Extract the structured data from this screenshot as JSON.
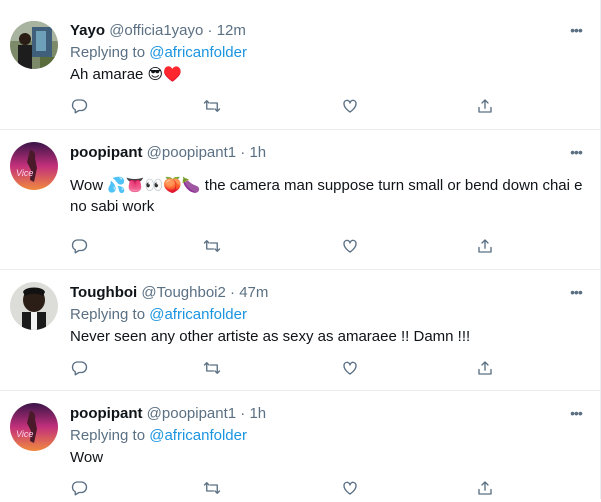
{
  "tweets": [
    {
      "name": "Yayo",
      "handle": "@officia1yayo",
      "time": "12m",
      "replying_prefix": "Replying to",
      "replying_to": "@africanfolder",
      "text": "Ah amarae 😎♥️"
    },
    {
      "name": "poopipant",
      "handle": "@poopipant1",
      "time": "1h",
      "replying_prefix": "",
      "replying_to": "",
      "text": "Wow 💦👅👀🍑🍆 the camera man suppose turn small or bend down chai e no sabi work"
    },
    {
      "name": "Toughboi",
      "handle": "@Toughboi2",
      "time": "47m",
      "replying_prefix": "Replying to",
      "replying_to": "@africanfolder",
      "text": "Never seen any other artiste as sexy as amaraee !! Damn !!!"
    },
    {
      "name": "poopipant",
      "handle": "@poopipant1",
      "time": "1h",
      "replying_prefix": "Replying to",
      "replying_to": "@africanfolder",
      "text": "Wow"
    }
  ],
  "separator": "·",
  "more_glyph": "•••",
  "colors": {
    "text": "#0f1419",
    "secondary": "#5b7083",
    "link": "#1b95e0",
    "border": "#ebeef0"
  }
}
